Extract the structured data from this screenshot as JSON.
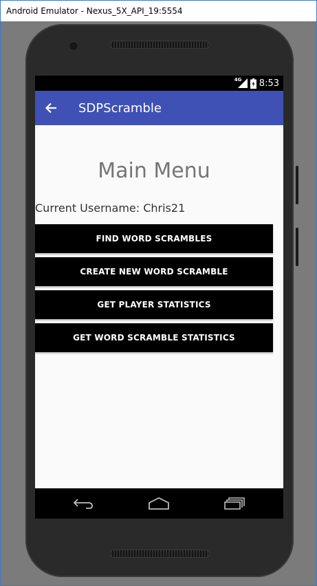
{
  "window": {
    "title": "Android Emulator - Nexus_5X_API_19:5554"
  },
  "statusbar": {
    "network": "4G",
    "time": "8:53",
    "icons": [
      "signal-icon",
      "battery-icon"
    ]
  },
  "appbar": {
    "title": "SDPScramble",
    "back_icon": "arrow-left-icon",
    "color": "#3f51b5"
  },
  "main": {
    "title": "Main Menu",
    "username_label": "Current Username: Chris21",
    "buttons": [
      {
        "label": "FIND WORD SCRAMBLES"
      },
      {
        "label": "CREATE NEW WORD SCRAMBLE"
      },
      {
        "label": "GET PLAYER STATISTICS"
      },
      {
        "label": "GET WORD SCRAMBLE STATISTICS"
      }
    ]
  },
  "navbar": {
    "icons": [
      "back-icon",
      "home-icon",
      "recents-icon"
    ]
  }
}
